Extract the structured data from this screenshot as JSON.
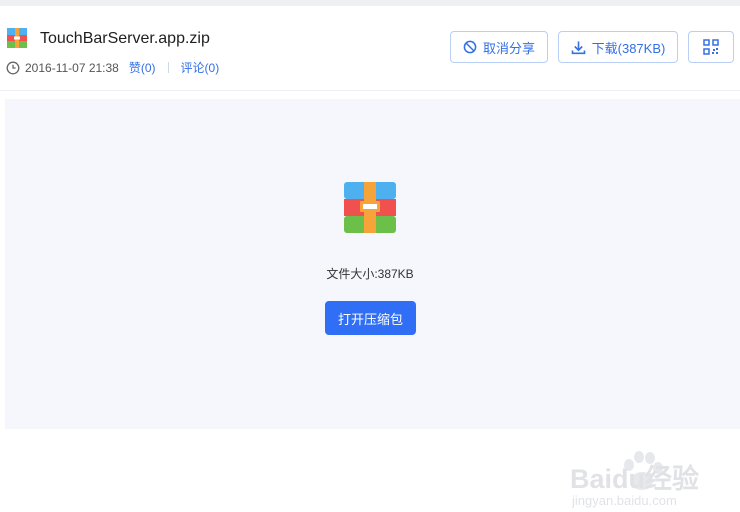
{
  "file": {
    "name": "TouchBarServer.app.zip",
    "date": "2016-11-07 21:38",
    "like_label": "赞(0)",
    "comment_label": "评论(0)"
  },
  "actions": {
    "cancel_share": "取消分享",
    "download": "下载(387KB)"
  },
  "preview": {
    "file_size": "文件大小:387KB",
    "open_button": "打开压缩包"
  },
  "watermark": {
    "logo": "Baidu经验",
    "sub": "jingyan.baidu.com"
  },
  "colors": {
    "accent": "#3370e6",
    "primary_button": "#2f6ef5",
    "preview_bg": "#f5f7fc"
  }
}
